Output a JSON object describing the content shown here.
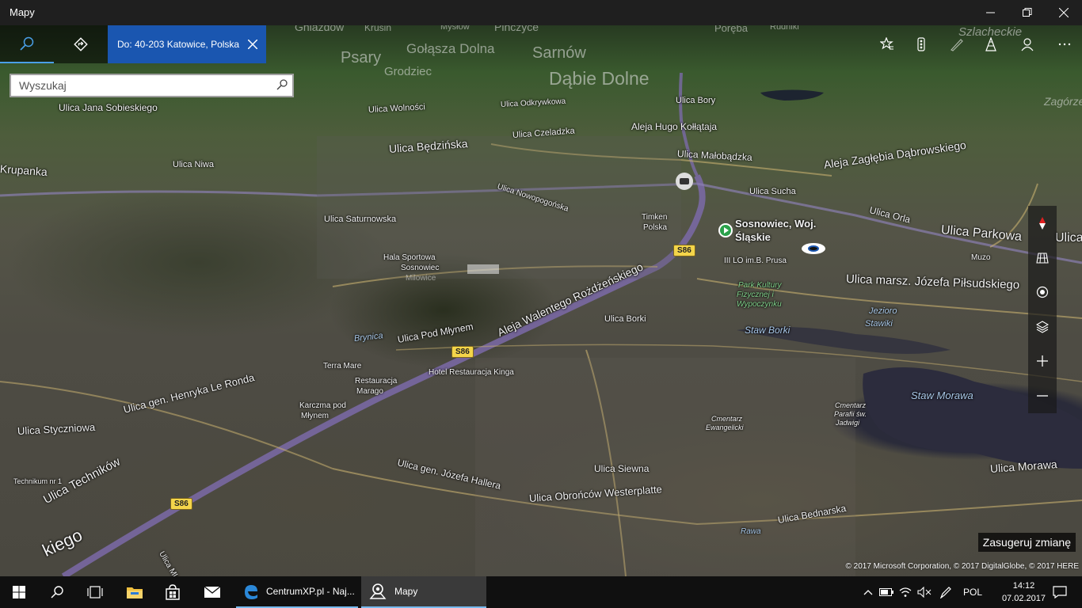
{
  "window": {
    "title": "Mapy"
  },
  "toolbar": {
    "destination_label": "Do: 40-203 Katowice, Polska",
    "search_placeholder": "Wyszukaj"
  },
  "map": {
    "places": {
      "gniazdow": "Gniazdów",
      "krusin": "Krusin",
      "myslow": "Mysłów",
      "pinczyce": "Pińczyce",
      "poreba": "Poręba",
      "rudniki": "Rudniki",
      "szlacheckie": "Szlacheckie",
      "psary": "Psary",
      "golasza": "Gołąsza Dolna",
      "sarnow": "Sarnów",
      "grodziec": "Grodziec",
      "dabie": "Dąbie Dolne",
      "zagorze": "Zagórze",
      "sosnowiec": "Sosnowiec, Woj.",
      "sosnowiec2": "Śląskie",
      "timken": "Timken",
      "timken2": "Polska"
    },
    "streets": {
      "sobieskiego": "Ulica Jana Sobieskiego",
      "wolnosci": "Ulica Wolności",
      "odkrywkowa": "Ulica Odkrywkowa",
      "bory": "Ulica Bory",
      "kollataja": "Aleja Hugo Kołłątaja",
      "czeladzka": "Ulica Czeladzka",
      "bedzinska": "Ulica Będzińska",
      "malobadzka": "Ulica Małobądzka",
      "zaglebia": "Aleja Zagłębia Dąbrowskiego",
      "krupanka": "Krupanka",
      "niwa": "Ulica Niwa",
      "nowopogonska": "Ulica Nowopogońska",
      "sucha": "Ulica Sucha",
      "orla": "Ulica Orla",
      "parkowa": "Ulica Parkowa",
      "ulica_edge": "Ulica",
      "saturnowska": "Ulica Saturnowska",
      "pilsudskiego": "Ulica marsz. Józefa Piłsudskiego",
      "rozdzienskiego": "Aleja Walentego Rożdżeńskiego",
      "pod_mlynem": "Ulica Pod Młynem",
      "borki": "Ulica Borki",
      "styczniowa": "Ulica Styczniowa",
      "le_ronda": "Ulica gen. Henryka Le Ronda",
      "technikow": "Ulica Techników",
      "hallera": "Ulica gen. Józefa Hallera",
      "siewna": "Ulica Siewna",
      "westerplatte": "Ulica Obrońców Westerplatte",
      "bednarska": "Ulica Bednarska",
      "morawa": "Ulica Morawa",
      "kiego": "kiego",
      "mlecz": "Ulica Mlecz"
    },
    "pois": {
      "hala": "Hala Sportowa",
      "hala2": "Sosnowiec",
      "hala3": "Milowice",
      "lo": "III LO im.B. Prusa",
      "muzo": "Muzo",
      "park": "Park Kultury",
      "park2": "Fizycznej i",
      "park3": "Wypoczynku",
      "jezioro": "Jezioro",
      "jezioro2": "Stawiki",
      "staw_borki": "Staw Borki",
      "staw_morawa": "Staw Morawa",
      "brynica": "Brynica",
      "terra": "Terra Mare",
      "restauracja": "Restauracja",
      "restauracja2": "Marago",
      "hotel": "Hotel Restauracja Kinga",
      "karczma": "Karczma pod",
      "karczma2": "Młynem",
      "technikum": "Technikum nr 1",
      "cmentarz_ew": "Cmentarz",
      "cmentarz_ew2": "Ewangelicki",
      "cmentarz_p": "Cmentarz",
      "cmentarz_p2": "Parafii św.",
      "cmentarz_p3": "Jadwigi",
      "rawa": "Rawa"
    },
    "shields": {
      "s86": "S86"
    },
    "suggest": "Zasugeruj zmianę",
    "copyright": "© 2017 Microsoft Corporation, © 2017 DigitalGlobe, © 2017 HERE"
  },
  "taskbar": {
    "apps": [
      {
        "label": "CentrumXP.pl - Naj..."
      },
      {
        "label": "Mapy"
      }
    ],
    "language": "POL",
    "time": "14:12",
    "date": "07.02.2017"
  },
  "colors": {
    "accent": "#1a56b0",
    "titlebar": "#1f1f1f",
    "taskbar": "#101010",
    "highway": "#7b6aa8",
    "shield": "#f4d54a"
  }
}
